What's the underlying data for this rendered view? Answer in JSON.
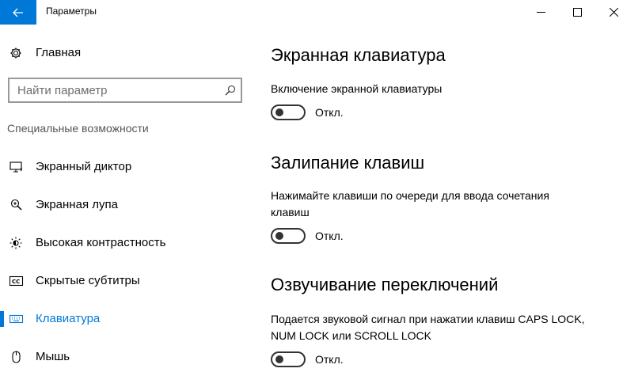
{
  "window": {
    "title": "Параметры",
    "accent": "#0078d7"
  },
  "sidebar": {
    "home_label": "Главная",
    "search_placeholder": "Найти параметр",
    "section_header": "Специальные возможности",
    "items": [
      {
        "label": "Экранный диктор",
        "icon": "narrator-icon",
        "active": false
      },
      {
        "label": "Экранная лупа",
        "icon": "magnifier-icon",
        "active": false
      },
      {
        "label": "Высокая контрастность",
        "icon": "contrast-icon",
        "active": false
      },
      {
        "label": "Скрытые субтитры",
        "icon": "closed-captions-icon",
        "active": false
      },
      {
        "label": "Клавиатура",
        "icon": "keyboard-icon",
        "active": true
      },
      {
        "label": "Мышь",
        "icon": "mouse-icon",
        "active": false
      }
    ]
  },
  "main": {
    "sections": [
      {
        "title": "Экранная клавиатура",
        "description": "Включение экранной клавиатуры",
        "toggle_state": "Откл.",
        "toggle_on": false
      },
      {
        "title": "Залипание клавиш",
        "description": "Нажимайте клавиши по очереди для ввода сочетания клавиш",
        "toggle_state": "Откл.",
        "toggle_on": false
      },
      {
        "title": "Озвучивание переключений",
        "description": "Подается звуковой сигнал при нажатии клавиш CAPS LOCK, NUM LOCK или SCROLL LOCK",
        "toggle_state": "Откл.",
        "toggle_on": false
      }
    ]
  }
}
